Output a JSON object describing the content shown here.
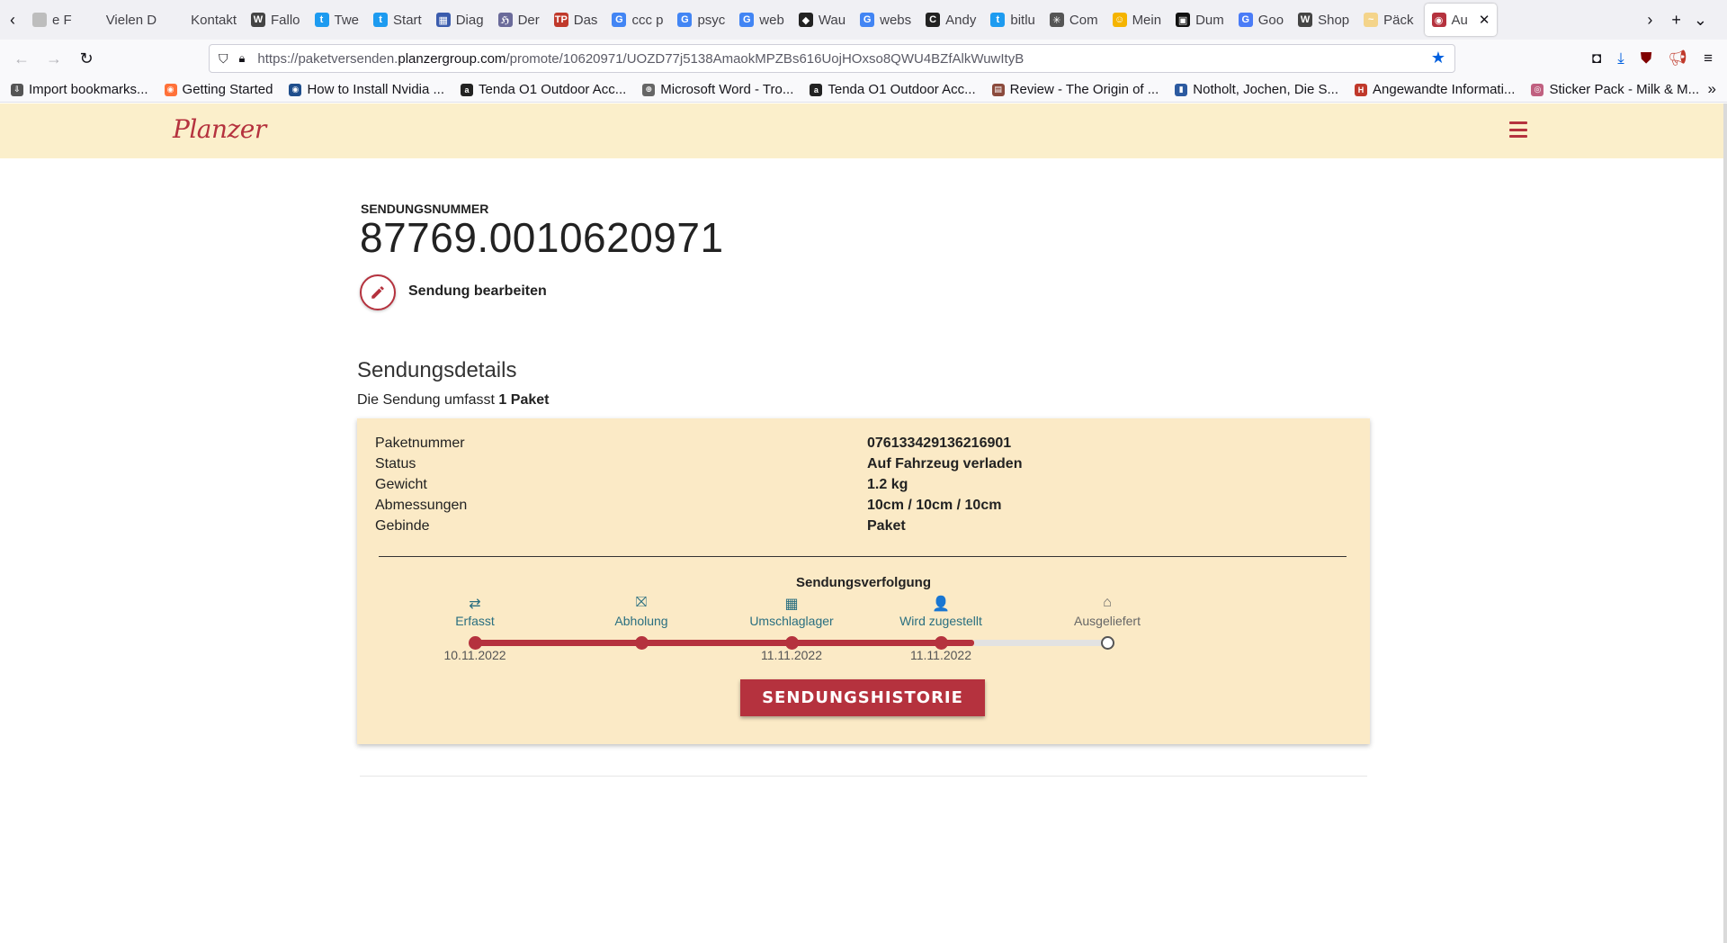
{
  "browser": {
    "tabs": [
      {
        "label": "e F",
        "fav": "",
        "color": "#bdbdbd"
      },
      {
        "label": "Vielen D",
        "fav": "",
        "color": "#ffffff"
      },
      {
        "label": "Kontakt",
        "fav": "",
        "color": "#ffffff"
      },
      {
        "label": "Fallo",
        "fav": "W",
        "color": "#444444"
      },
      {
        "label": "Twe",
        "fav": "t",
        "color": "#1d9bf0"
      },
      {
        "label": "Start",
        "fav": "t",
        "color": "#1d9bf0"
      },
      {
        "label": "Diag",
        "fav": "▦",
        "color": "#3b5cad"
      },
      {
        "label": "Der",
        "fav": "ℌ",
        "color": "#6a6a9a"
      },
      {
        "label": "Das",
        "fav": "TP",
        "color": "#c0392b"
      },
      {
        "label": "ccc p",
        "fav": "G",
        "color": "#4285f4"
      },
      {
        "label": "psyc",
        "fav": "G",
        "color": "#4285f4"
      },
      {
        "label": "web",
        "fav": "G",
        "color": "#4285f4"
      },
      {
        "label": "Wau",
        "fav": "◆",
        "color": "#222222"
      },
      {
        "label": "webs",
        "fav": "G",
        "color": "#4285f4"
      },
      {
        "label": "Andy",
        "fav": "C",
        "color": "#222222"
      },
      {
        "label": "bitlu",
        "fav": "t",
        "color": "#1d9bf0"
      },
      {
        "label": "Com",
        "fav": "✳",
        "color": "#555555"
      },
      {
        "label": "Mein",
        "fav": "☺",
        "color": "#f5b400"
      },
      {
        "label": "Dum",
        "fav": "▣",
        "color": "#111111"
      },
      {
        "label": "Goo",
        "fav": "G",
        "color": "#4a7cf7"
      },
      {
        "label": "Shop",
        "fav": "W",
        "color": "#444444"
      },
      {
        "label": "Päck",
        "fav": "~",
        "color": "#f4d48a"
      }
    ],
    "active_tab": {
      "label": "Au",
      "fav": "◉",
      "color": "#b5323e"
    },
    "url_prefix": "https://paketversenden.",
    "url_domain": "planzergroup.com",
    "url_path": "/promote/10620971/UOZD77j5138AmaokMPZBs616UojHOxso8QWU4BZfAlkWuwItyB",
    "bookmarks": [
      {
        "label": "Import bookmarks...",
        "fav": "⇩",
        "color": "#555555"
      },
      {
        "label": "Getting Started",
        "fav": "◉",
        "color": "#ff7139"
      },
      {
        "label": "How to Install Nvidia ...",
        "fav": "◉",
        "color": "#1f4e8c"
      },
      {
        "label": "Tenda O1 Outdoor Acc...",
        "fav": "a",
        "color": "#222222"
      },
      {
        "label": "Microsoft Word - Tro...",
        "fav": "⊕",
        "color": "#666666"
      },
      {
        "label": "Tenda O1 Outdoor Acc...",
        "fav": "a",
        "color": "#222222"
      },
      {
        "label": "Review - The Origin of ...",
        "fav": "▤",
        "color": "#8b4a3c"
      },
      {
        "label": "Notholt, Jochen, Die S...",
        "fav": "▮",
        "color": "#2c5aa0"
      },
      {
        "label": "Angewandte Informati...",
        "fav": "H",
        "color": "#c0392b"
      },
      {
        "label": "Sticker Pack - Milk & M...",
        "fav": "◎",
        "color": "#c06080"
      }
    ]
  },
  "site": {
    "logo": "Planzer",
    "accent_color": "#b5323e",
    "header_bg": "#fbefcb"
  },
  "shipment": {
    "number_label": "SENDUNGSNUMMER",
    "number": "87769.0010620971",
    "edit_label": "Sendung bearbeiten",
    "details_title": "Sendungsdetails",
    "summary_prefix": "Die Sendung umfasst ",
    "summary_count": "1 Paket",
    "details": [
      {
        "key": "Paketnummer",
        "value": "076133429136216901"
      },
      {
        "key": "Status",
        "value": "Auf Fahrzeug verladen"
      },
      {
        "key": "Gewicht",
        "value": "1.2 kg"
      },
      {
        "key": "Abmessungen",
        "value": "10cm / 10cm / 10cm"
      },
      {
        "key": "Gebinde",
        "value": "Paket"
      }
    ],
    "tracking_title": "Sendungsverfolgung",
    "steps": [
      {
        "name": "Erfasst",
        "icon": "transfer-icon",
        "glyph": "⇄",
        "date": "10.11.2022",
        "done": true
      },
      {
        "name": "Abholung",
        "icon": "gift-icon",
        "glyph": "⛝",
        "date": "",
        "done": true
      },
      {
        "name": "Umschlaglager",
        "icon": "boxes-icon",
        "glyph": "▦",
        "date": "11.11.2022",
        "done": true
      },
      {
        "name": "Wird zugestellt",
        "icon": "person-icon",
        "glyph": "👤",
        "date": "11.11.2022",
        "done": true
      },
      {
        "name": "Ausgeliefert",
        "icon": "home-icon",
        "glyph": "⌂",
        "date": "",
        "done": false
      }
    ],
    "progress": 0.79,
    "history_button": "SENDUNGSHISTORIE"
  }
}
